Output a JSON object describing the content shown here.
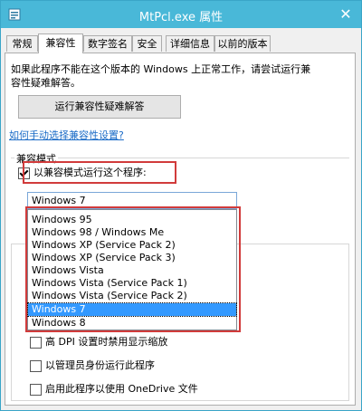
{
  "window": {
    "title": "MtPcl.exe 属性",
    "close_symbol": "✕",
    "icon": "app-icon"
  },
  "tabs": [
    {
      "label": "常规",
      "active": false
    },
    {
      "label": "兼容性",
      "active": true
    },
    {
      "label": "数字签名",
      "active": false
    },
    {
      "label": "安全",
      "active": false
    },
    {
      "label": "详细信息",
      "active": false
    },
    {
      "label": "以前的版本",
      "active": false
    }
  ],
  "compat": {
    "intro_line1": "如果此程序不能在这个版本的 Windows 上正常工作，请尝试运行兼",
    "intro_line2": "容性疑难解答。",
    "troubleshoot_button": "运行兼容性疑难解答",
    "manual_link": "如何手动选择兼容性设置?",
    "mode_group_label": "兼容模式",
    "mode_checkbox_label": "以兼容模式运行这个程序:",
    "mode_checked": true,
    "selected_os": "Windows 7",
    "os_options": [
      "Windows 95",
      "Windows 98 / Windows Me",
      "Windows XP (Service Pack 2)",
      "Windows XP (Service Pack 3)",
      "Windows Vista",
      "Windows Vista (Service Pack 1)",
      "Windows Vista (Service Pack 2)",
      "Windows 7",
      "Windows 8"
    ],
    "highlighted_index": 7,
    "settings": [
      {
        "label": "高 DPI 设置时禁用显示缩放",
        "checked": false
      },
      {
        "label": "以管理员身份运行此程序",
        "checked": false
      },
      {
        "label": "启用此程序以使用 OneDrive 文件",
        "checked": false
      }
    ]
  },
  "colors": {
    "titlebar": "#49b8d8",
    "highlight_border": "#d13b3b",
    "selection": "#3399ff"
  }
}
